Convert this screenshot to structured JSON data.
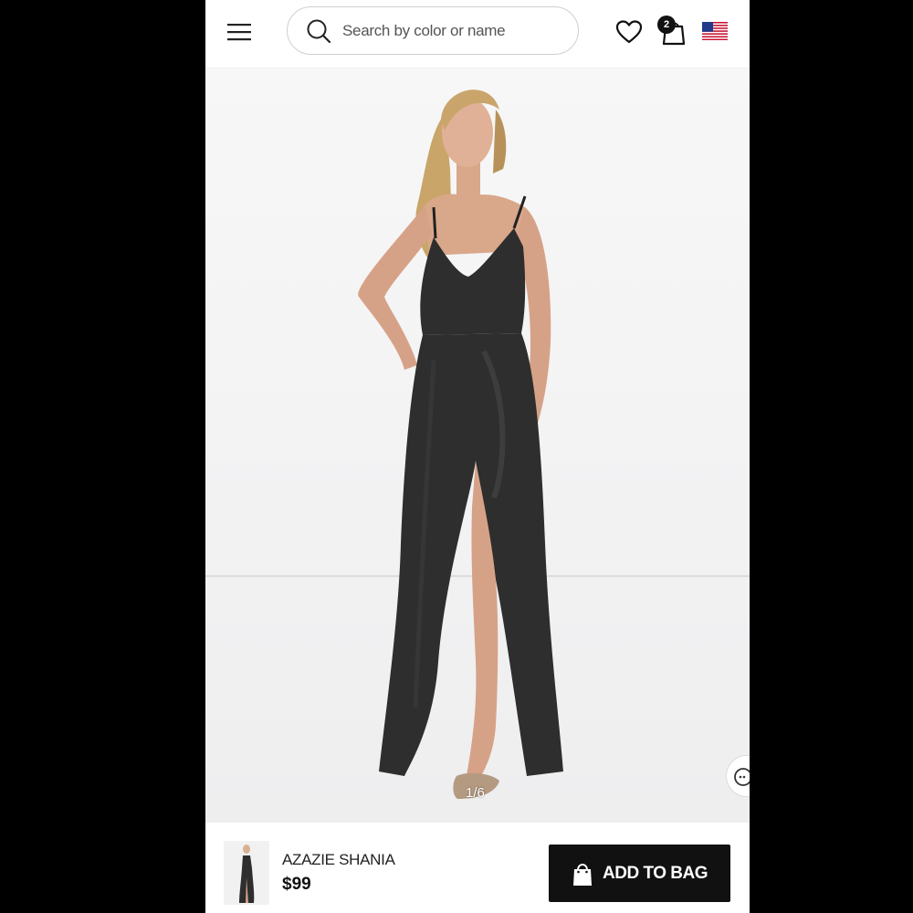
{
  "header": {
    "search": {
      "placeholder": "Search by color or name"
    },
    "cart": {
      "count": "2"
    },
    "icons": {
      "menu": "hamburger-menu-icon",
      "search": "search-icon",
      "wishlist": "heart-icon",
      "cart": "shopping-bag-icon",
      "region": "us-flag-icon"
    }
  },
  "gallery": {
    "counter": "1/6"
  },
  "bottom_bar": {
    "product_name": "AZAZIE SHANIA",
    "price": "$99",
    "add_button_label": "ADD TO BAG"
  },
  "colors": {
    "button": "#111111",
    "dress": "#2d2e2d",
    "background": "#ffffff",
    "page_frame": "#000000"
  }
}
